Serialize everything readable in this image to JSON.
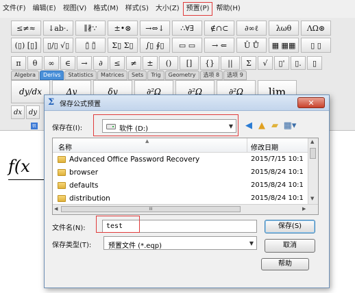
{
  "menu": [
    "文件(F)",
    "编辑(E)",
    "视图(V)",
    "格式(M)",
    "样式(S)",
    "大小(Z)",
    "预置(P)",
    "帮助(H)"
  ],
  "toolbar": {
    "row1": [
      "≤≠≈",
      "↓ab·.",
      "∥∦∵",
      "±•⊗",
      "→⇔↓",
      "∴∀∃",
      "∉∩⊂",
      "∂∞ℓ",
      "λωθ",
      "ΛΩ⊛"
    ],
    "row2": [
      "(▯) [▯]",
      "▯/▯ √▯",
      "▯̄ ▯̃",
      "Σ▯ Σ▯",
      "∫▯ ∮▯",
      "▭ ▭",
      "→ ⇐",
      "Ū Ů",
      "▦ ▦▦",
      "▯ ▯"
    ],
    "row3": [
      "π",
      "θ",
      "∞",
      "∈",
      "→",
      "∂",
      "≤",
      "≠",
      "±",
      "()",
      "[]",
      "{}",
      "||",
      "Σ",
      "√",
      "▯'",
      "▯.",
      "▯"
    ],
    "tabs": [
      "Algebra",
      "Derivs",
      "Statistics",
      "Matrices",
      "Sets",
      "Trig",
      "Geometry",
      "选项 8",
      "选项 9"
    ],
    "active_tab": "Derivs",
    "templates": [
      "dy/dx",
      "Δy",
      "δy",
      "∂²Ω",
      "∂²Ω",
      "∂²Ω",
      "lim"
    ],
    "small": [
      "dx",
      "dy"
    ],
    "mark": "tt"
  },
  "document": {
    "formula": "f(x"
  },
  "dialog": {
    "title": "保存公式预置",
    "close_label": "✕",
    "save_in_label": "保存在(I):",
    "location": "软件 (D:)",
    "columns": {
      "name": "名称",
      "date": "修改日期"
    },
    "files": [
      {
        "name": "Advanced Office Password Recovery",
        "date": "2015/7/15 10:1"
      },
      {
        "name": "browser",
        "date": "2015/8/24 10:1"
      },
      {
        "name": "defaults",
        "date": "2015/8/24 10:1"
      },
      {
        "name": "distribution",
        "date": "2015/8/24 10:1"
      }
    ],
    "filename_label": "文件名(N):",
    "filename_value": "test",
    "filetype_label": "保存类型(T):",
    "filetype_value": "预置文件 (*.eqp)",
    "buttons": {
      "save": "保存(S)",
      "cancel": "取消",
      "help": "帮助"
    },
    "scroll_grip": "III"
  },
  "colors": {
    "highlight": "#e03a3a",
    "accent": "#4a90d9",
    "close": "#c8412b"
  }
}
